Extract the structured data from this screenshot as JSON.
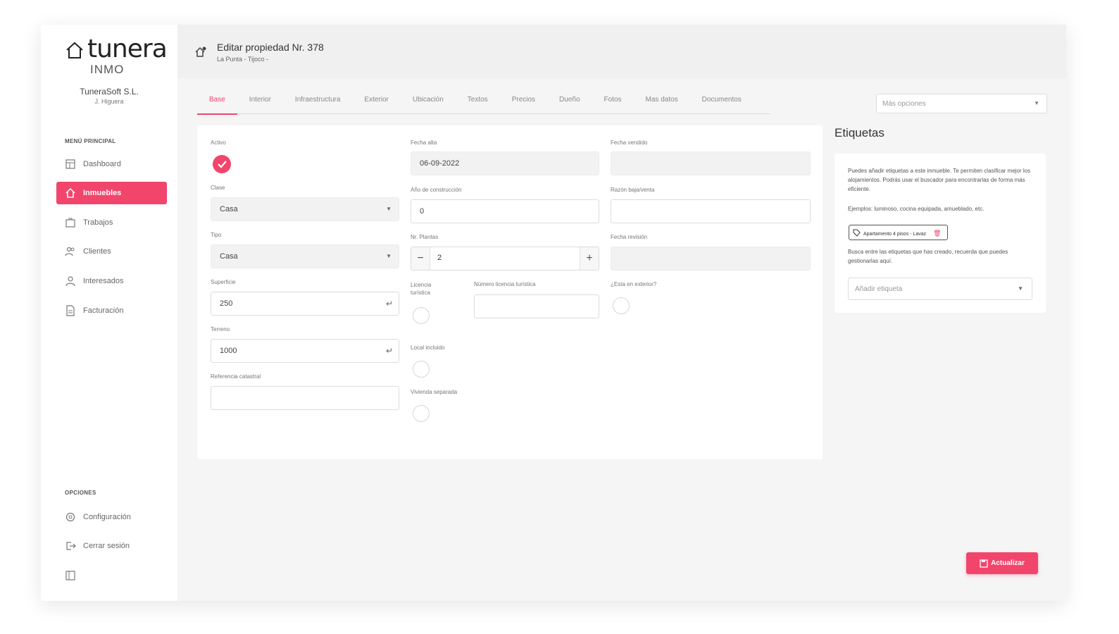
{
  "app": {
    "logo": "tunera",
    "logo_sub": "INMO",
    "company": "TuneraSoft S.L.",
    "user": "J. Higuera"
  },
  "sidebar": {
    "main_menu_label": "MENÚ PRINCIPAL",
    "items": [
      {
        "label": "Dashboard",
        "icon": "dashboard-icon"
      },
      {
        "label": "Inmuebles",
        "icon": "home-icon",
        "active": true
      },
      {
        "label": "Trabajos",
        "icon": "briefcase-icon"
      },
      {
        "label": "Clientes",
        "icon": "users-icon"
      },
      {
        "label": "Interesados",
        "icon": "user-icon"
      },
      {
        "label": "Facturación",
        "icon": "invoice-icon"
      }
    ],
    "options_label": "OPCIONES",
    "options": [
      {
        "label": "Configuración",
        "icon": "gear-icon"
      },
      {
        "label": "Cerrar sesión",
        "icon": "logout-icon"
      }
    ]
  },
  "header": {
    "title": "Editar propiedad Nr. 378",
    "subtitle": "La Punta - Tijoco -"
  },
  "tabs": [
    "Base",
    "Interior",
    "Infraestructura",
    "Exterior",
    "Ubicación",
    "Textos",
    "Precios",
    "Dueño",
    "Fotos",
    "Mas datos",
    "Documentos"
  ],
  "more_options": {
    "placeholder": "Más opciones"
  },
  "form": {
    "activo": {
      "label": "Activo",
      "checked": true
    },
    "clase": {
      "label": "Clase",
      "value": "Casa"
    },
    "tipo": {
      "label": "Tipo",
      "value": "Casa"
    },
    "superficie": {
      "label": "Superficie",
      "value": "250"
    },
    "terreno": {
      "label": "Terreno",
      "value": "1000"
    },
    "referencia_catastral": {
      "label": "Referencia catastral",
      "value": ""
    },
    "fecha_alta": {
      "label": "Fecha alta",
      "value": "06-09-2022"
    },
    "anio_construccion": {
      "label": "Año de construcción",
      "value": "0"
    },
    "nr_plantas": {
      "label": "Nr. Plantas",
      "value": "2"
    },
    "licencia_turistica": {
      "label": "Licencia turística",
      "checked": false
    },
    "numero_licencia": {
      "label": "Número licencia turística",
      "value": ""
    },
    "local_incluido": {
      "label": "Local incluido",
      "checked": false
    },
    "vivienda_separada": {
      "label": "Vivienda separada",
      "checked": false
    },
    "fecha_vendido": {
      "label": "Fecha vendido",
      "value": ""
    },
    "razon_baja": {
      "label": "Razón baja/venta",
      "value": ""
    },
    "fecha_revision": {
      "label": "Fecha revisión",
      "value": ""
    },
    "esta_en_exterior": {
      "label": "¿Esta en exterior?",
      "checked": false
    }
  },
  "tags": {
    "title": "Etiquetas",
    "intro": "Puedes añadir etiquetas a este inmueble. Te permiten clasificar mejor los alojamientos. Podrás usar el buscador para encontrarlas de forma más eficiente.",
    "example": "Ejemplos: luminoso, cocina equipada, amueblado, etc.",
    "chip": "Apartamento 4 pisos - Lavaz",
    "help": "Busca entre las etiquetas que has creado, recuerda que puedes gestionarlas aquí.",
    "add_placeholder": "Añadir etiqueta"
  },
  "actions": {
    "update_label": "Actualizar"
  },
  "colors": {
    "accent": "#f2456c",
    "background": "#f5f5f5"
  }
}
